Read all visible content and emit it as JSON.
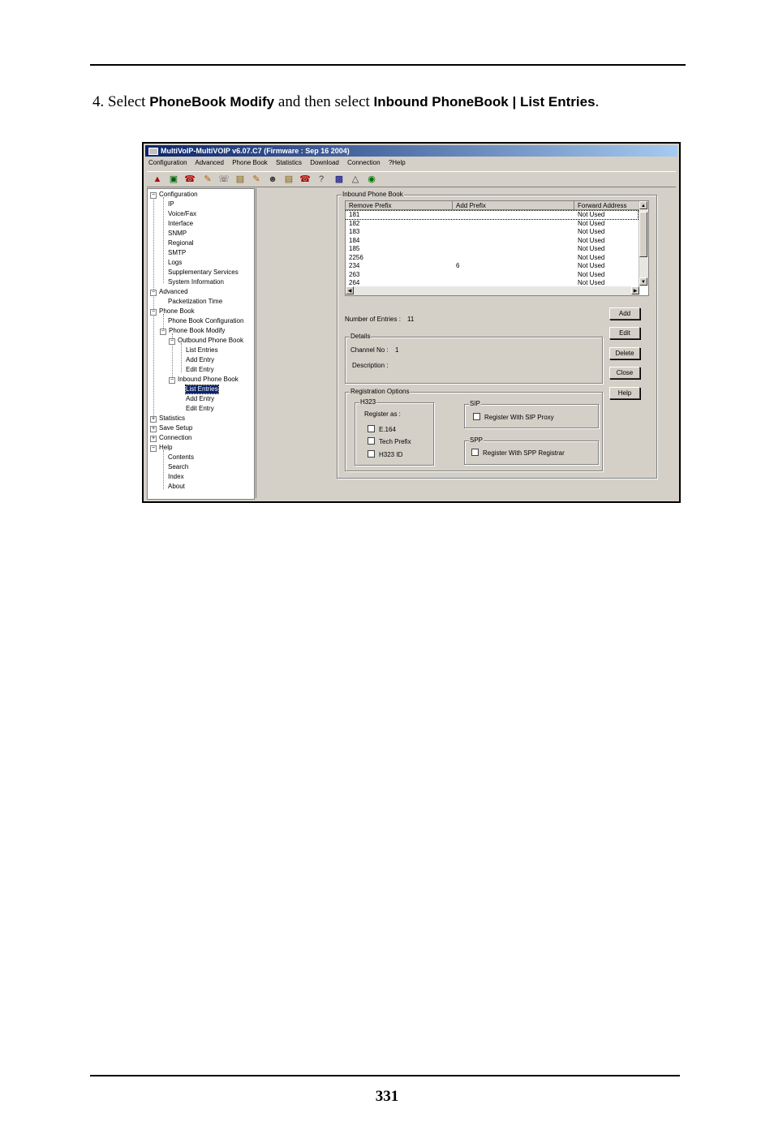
{
  "doc": {
    "step_prefix": "4. Select ",
    "step_bold1": "PhoneBook Modify",
    "step_mid": " and then select ",
    "step_bold2": "Inbound PhoneBook | List Entries",
    "step_end": ".",
    "page_number": "331"
  },
  "window": {
    "title": "MultiVoIP-MultiVOIP v6.07.C7 (Firmware : Sep 16 2004)",
    "menu": [
      "Configuration",
      "Advanced",
      "Phone Book",
      "Statistics",
      "Download",
      "Connection",
      "?Help"
    ],
    "toolbar_icons": [
      "network-icon",
      "monitor-icon",
      "phone-icon",
      "edit-icon",
      "call-icon",
      "book-icon",
      "edit2-icon",
      "person-icon",
      "book2-icon",
      "phone2-icon",
      "question-icon",
      "save-icon",
      "upload-icon",
      "globe-icon"
    ]
  },
  "tree": {
    "configuration": "Configuration",
    "ip": "IP",
    "voice_fax": "Voice/Fax",
    "interface": "Interface",
    "snmp": "SNMP",
    "regional": "Regional",
    "smtp": "SMTP",
    "logs": "Logs",
    "supplementary": "Supplementary Services",
    "system_info": "System Information",
    "advanced": "Advanced",
    "packetization": "Packetization Time",
    "phone_book": "Phone Book",
    "pb_config": "Phone Book Configuration",
    "pb_modify": "Phone Book Modify",
    "outbound": "Outbound Phone Book",
    "out_list": "List Entries",
    "out_add": "Add Entry",
    "out_edit": "Edit Entry",
    "inbound": "Inbound Phone Book",
    "in_list": "List Entries",
    "in_add": "Add Entry",
    "in_edit": "Edit Entry",
    "statistics": "Statistics",
    "save_setup": "Save Setup",
    "connection": "Connection",
    "help": "Help",
    "contents": "Contents",
    "search": "Search",
    "index": "Index",
    "about": "About"
  },
  "inbound_group": {
    "label": "Inbound  Phone Book",
    "columns": [
      "Remove Prefix",
      "Add Prefix",
      "Forward Address"
    ],
    "rows": [
      {
        "remove": "181",
        "add": "",
        "forward": "Not Used"
      },
      {
        "remove": "182",
        "add": "",
        "forward": "Not Used"
      },
      {
        "remove": "183",
        "add": "",
        "forward": "Not Used"
      },
      {
        "remove": "184",
        "add": "",
        "forward": "Not Used"
      },
      {
        "remove": "185",
        "add": "",
        "forward": "Not Used"
      },
      {
        "remove": "2256",
        "add": "",
        "forward": "Not Used"
      },
      {
        "remove": "234",
        "add": "6",
        "forward": "Not Used"
      },
      {
        "remove": "263",
        "add": "",
        "forward": "Not Used"
      },
      {
        "remove": "264",
        "add": "",
        "forward": "Not Used"
      }
    ]
  },
  "entries": {
    "label": "Number of Entries :",
    "value": "11"
  },
  "buttons": {
    "add": "Add",
    "edit": "Edit",
    "delete": "Delete",
    "close": "Close",
    "help": "Help"
  },
  "details": {
    "label": "Details",
    "channel_label": "Channel No :",
    "channel_value": "1",
    "description_label": "Description :"
  },
  "registration": {
    "label": "Registration Options",
    "h323_label": "H323",
    "register_as": "Register as :",
    "e164": "E.164",
    "tech_prefix": "Tech Prefix",
    "h323_id": "H323 ID",
    "sip_label": "SIP",
    "sip_proxy": "Register With SIP Proxy",
    "spp_label": "SPP",
    "spp_registrar": "Register With SPP Registrar"
  }
}
